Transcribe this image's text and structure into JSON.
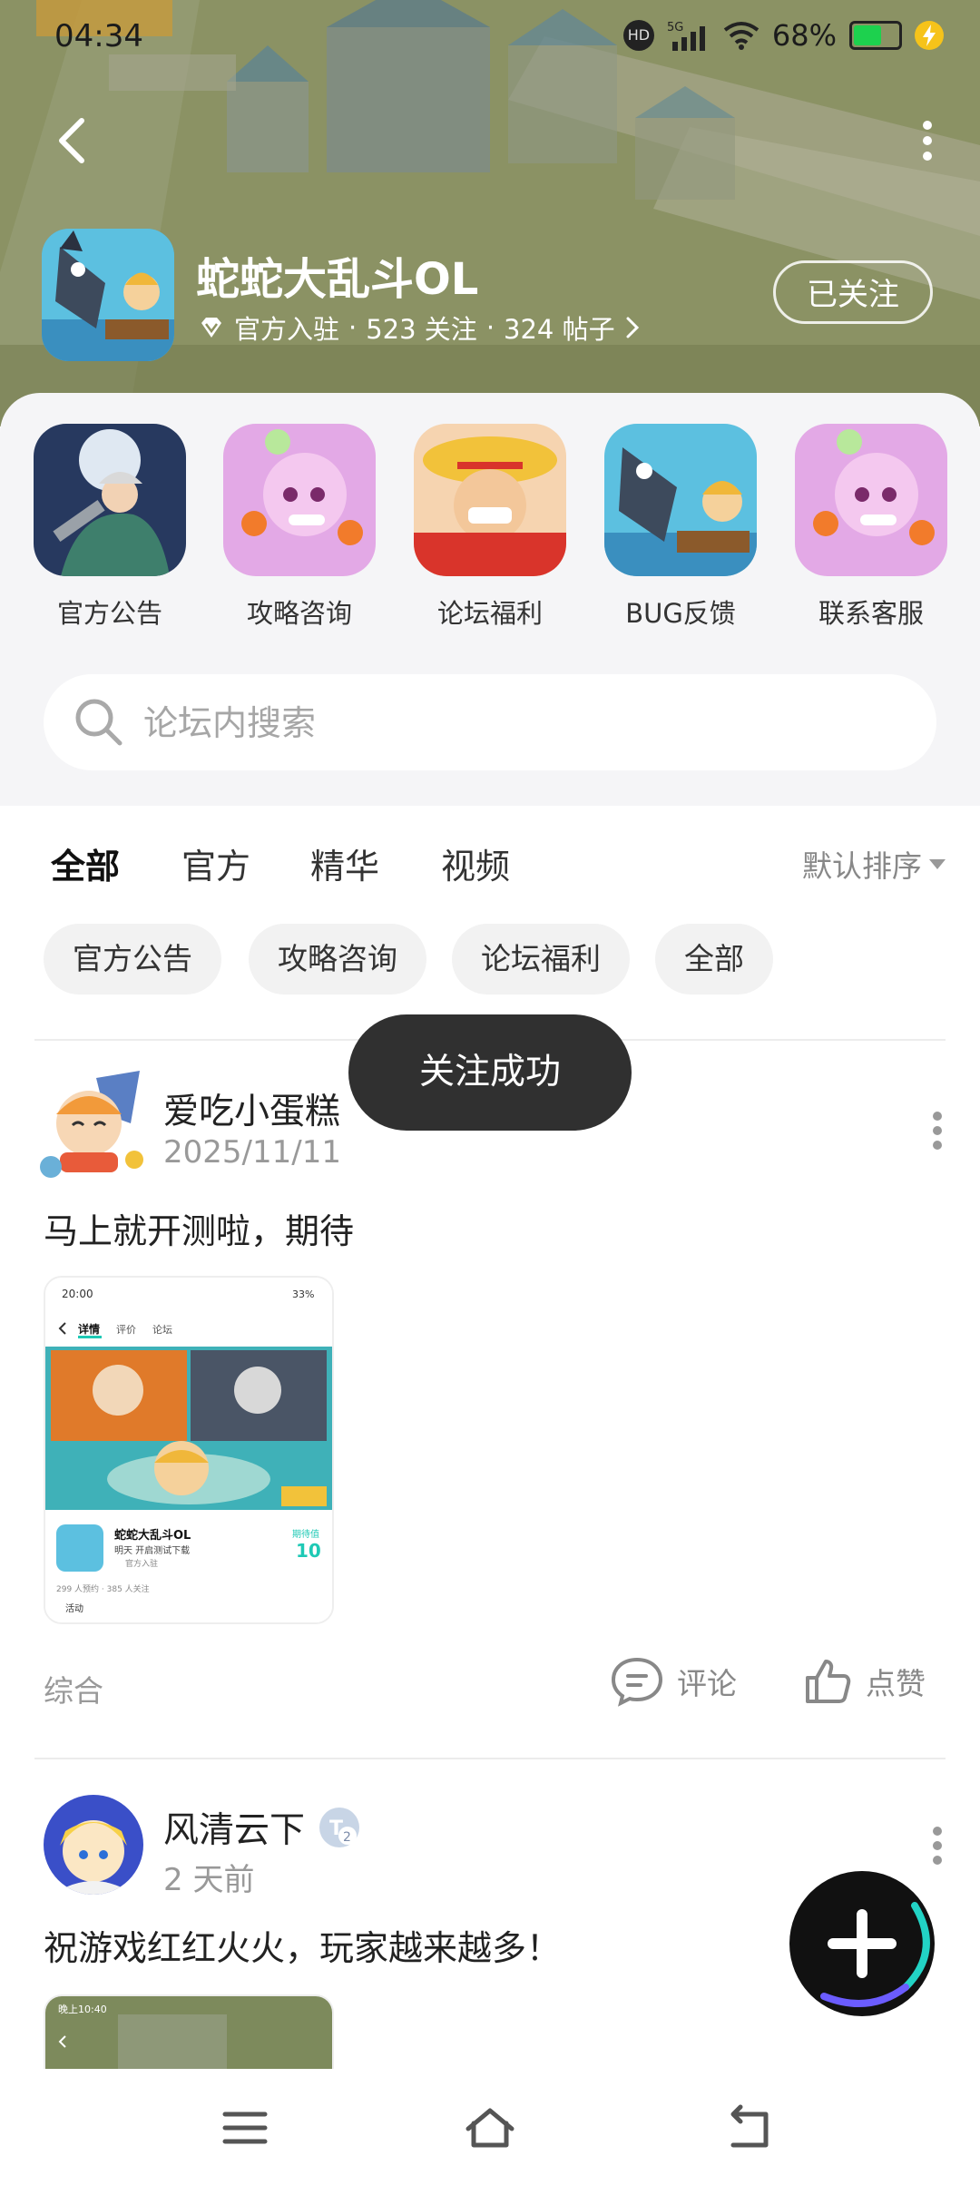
{
  "status_bar": {
    "time": "04:34",
    "battery_text": "68%",
    "battery_level": 0.68
  },
  "header": {
    "game_title": "蛇蛇大乱斗OL",
    "official_label": "官方入驻",
    "sep": "·",
    "followers": "523 关注",
    "posts": "324 帖子",
    "follow_button": "已关注"
  },
  "shortcuts": [
    {
      "label": "官方公告",
      "icon": "announcement-icon"
    },
    {
      "label": "攻略咨询",
      "icon": "guide-icon"
    },
    {
      "label": "论坛福利",
      "icon": "welfare-icon"
    },
    {
      "label": "BUG反馈",
      "icon": "bug-feedback-icon"
    },
    {
      "label": "联系客服",
      "icon": "customer-service-icon"
    }
  ],
  "search": {
    "placeholder": "论坛内搜索"
  },
  "tabs": [
    {
      "label": "全部",
      "active": true
    },
    {
      "label": "官方",
      "active": false
    },
    {
      "label": "精华",
      "active": false
    },
    {
      "label": "视频",
      "active": false
    }
  ],
  "sort_label": "默认排序",
  "chips": [
    "官方公告",
    "攻略咨询",
    "论坛福利",
    "全部"
  ],
  "toast": "关注成功",
  "posts": [
    {
      "username": "爱吃小蛋糕",
      "date": "2025/11/11",
      "text": "马上就开测啦，期待",
      "category": "综合",
      "comment_label": "评论",
      "like_label": "点赞",
      "thumb": {
        "time": "20:00",
        "battery": "33%",
        "tab_detail": "详情",
        "tab_review": "评价",
        "tab_forum": "论坛",
        "game_name": "蛇蛇大乱斗OL",
        "subtitle": "明天 开启测试下载",
        "official": "官方入驻",
        "score_label": "期待值",
        "score": "10",
        "stats": "299 人预约 · 385 人关注",
        "activity": "活动"
      }
    },
    {
      "username": "风清云下",
      "date": "2 天前",
      "text": "祝游戏红红火火，玩家越来越多！",
      "thumb": {
        "time": "晚上10:40"
      }
    }
  ],
  "colors": {
    "accent": "#1ec9b5",
    "header_bg": "#8d915f",
    "toast_bg": "#303030"
  }
}
